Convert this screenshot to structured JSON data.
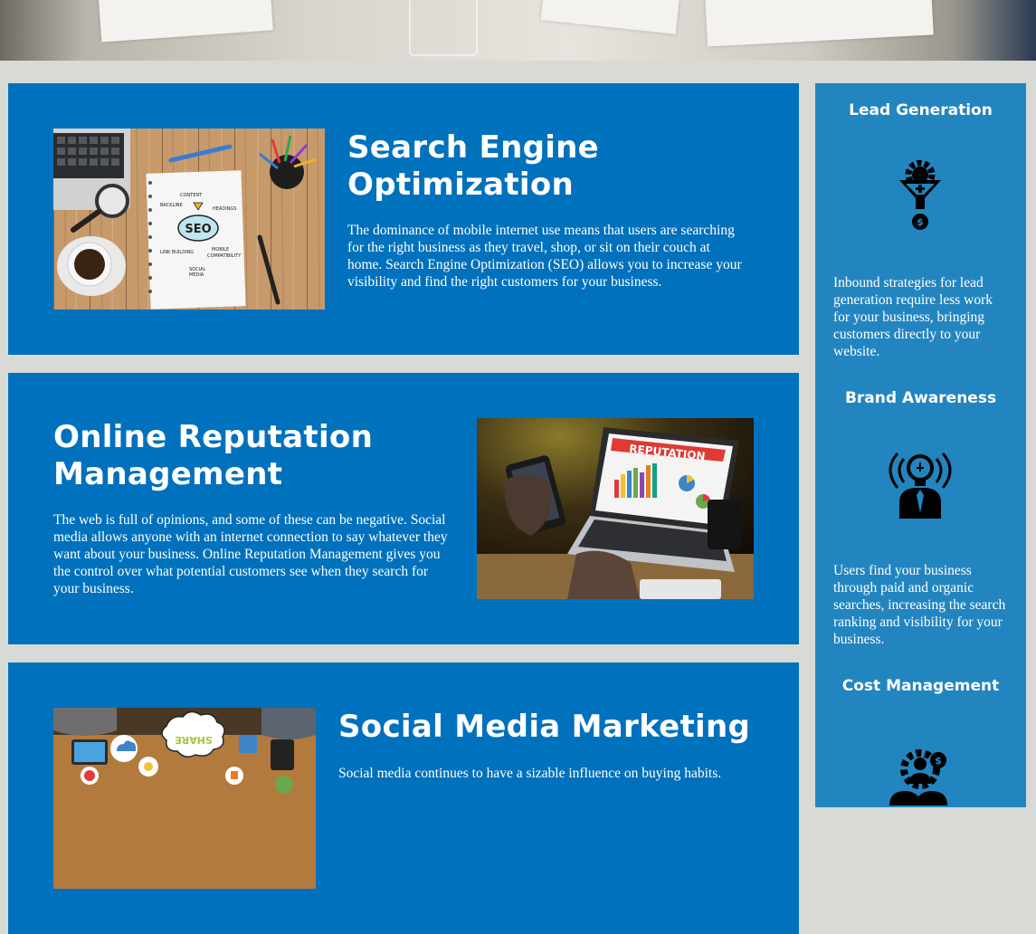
{
  "services": [
    {
      "title": "Search Engine Optimization",
      "body": "The dominance of mobile internet use means that users are searching for the right business as they travel, shop, or sit on their couch at home. Search Engine Optimization (SEO) allows you to increase your visibility and find the right customers for your business.",
      "notebook_words": [
        "CONTENT",
        "BACKLINK",
        "HEADINGS",
        "SEO",
        "LINK BUILDING",
        "MOBILE COMPATIBILITY",
        "SOCIAL MEDIA"
      ]
    },
    {
      "title": "Online Reputation Management",
      "body": "The web is full of opinions, and some of these can be negative. Social media allows anyone with an internet connection to say whatever they want about your business. Online Reputation Management gives you the control over what potential customers see when they search for your business.",
      "screen_word": "REPUTATION"
    },
    {
      "title": "Social Media Marketing",
      "body": "Social media continues to have a sizable influence on buying habits.",
      "bubble_word": "SHARE"
    }
  ],
  "benefits": [
    {
      "title": "Lead Generation",
      "icon": "funnel-gear-dollar-icon",
      "body": "Inbound strategies for lead generation require less work for your business, bringing customers directly to your website."
    },
    {
      "title": "Brand Awareness",
      "icon": "lightbulb-person-icon",
      "body": "Users find your business through paid and organic searches, increasing the search ranking and visibility for your business."
    },
    {
      "title": "Cost Management",
      "icon": "gear-person-dollar-icon"
    }
  ],
  "colors": {
    "page_background": "#d8dad6",
    "card_blue": "#0071bc",
    "sidebar_blue": "#2385bf",
    "text": "#ffffff"
  }
}
